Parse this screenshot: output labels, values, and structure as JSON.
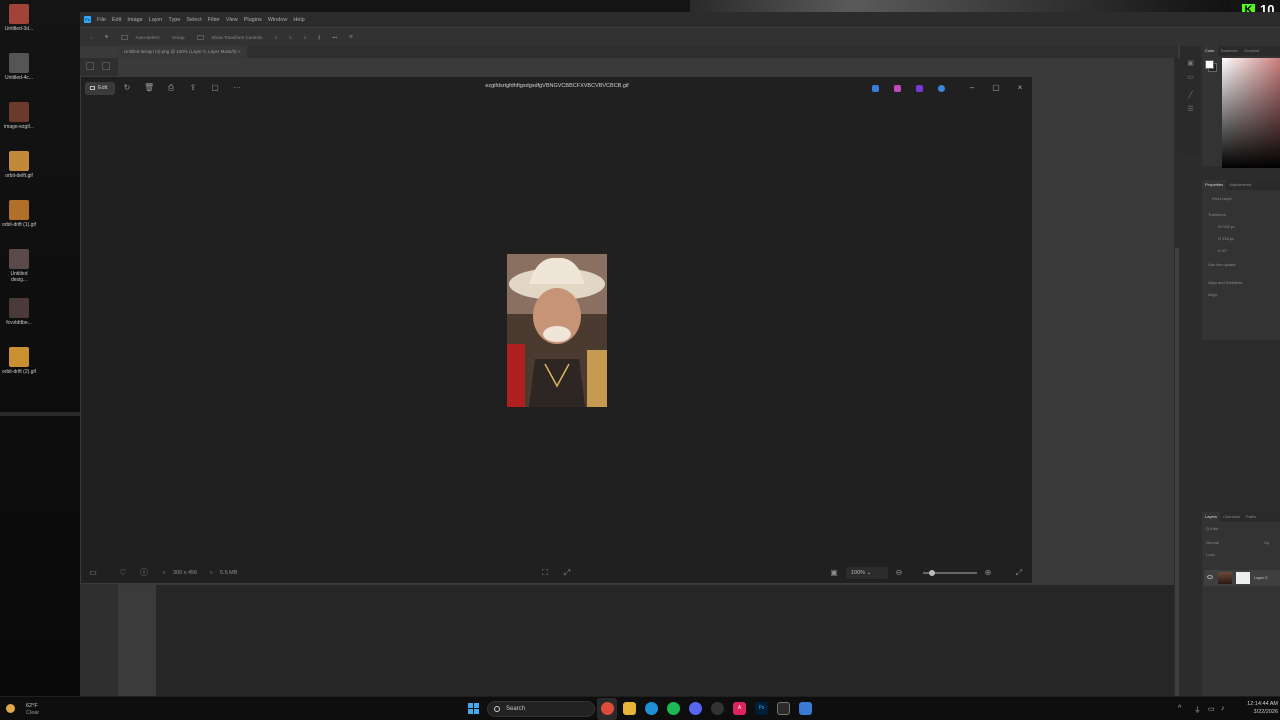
{
  "desktop": {
    "icons": [
      {
        "label": "Untitled-3d...",
        "color": "#a0443a"
      },
      {
        "label": "Untitled-4c...",
        "color": "#555555"
      },
      {
        "label": "image-ezgif...",
        "color": "#6a3a2a"
      },
      {
        "label": "orbit-delft.gif",
        "color": "#c08a3a"
      },
      {
        "label": "orbit-drift (1).gif",
        "color": "#b0702a"
      },
      {
        "label": "Untitled desig...",
        "color": "#5a4a4a"
      },
      {
        "label": "fcvvbfdbe...",
        "color": "#4a3a3a"
      },
      {
        "label": "orbit-drift (2).gif",
        "color": "#c89030"
      }
    ]
  },
  "photoshop": {
    "menu": [
      "File",
      "Edit",
      "Image",
      "Layer",
      "Type",
      "Select",
      "Filter",
      "View",
      "Plugins",
      "Window",
      "Help"
    ],
    "options": {
      "auto_select": "Auto-Select:",
      "layer_dropdown": "Group",
      "show_transform": "Show Transform Controls"
    },
    "tab_title": "Untitled design (4).png @ 100% (Layer 0, Layer Mask/8)",
    "panels": {
      "color_tabs": [
        "Color",
        "Swatches",
        "Gradient"
      ],
      "props_tabs": [
        "Properties",
        "Adjustments"
      ],
      "props_kind": "Pixel Layer",
      "transform_label": "Transform",
      "w_label": "W",
      "w_value": "128 px",
      "h_label": "H",
      "h_value": "128 px",
      "angle_value": "0.00°",
      "use_live": "Use live update",
      "align_label": "Align and Distribute",
      "align_sub": "Align:",
      "layers_tabs": [
        "Layers",
        "Channels",
        "Paths"
      ],
      "kind_label": "Q Kind",
      "blend_mode": "Normal",
      "opacity_label": "Op",
      "lock_label": "Lock:",
      "layer_name": "Layer 0"
    }
  },
  "viewer": {
    "edit_label": "Edit",
    "file_title": "ezgifdsrtgfdhftgsdgsdfgVBNGVCBBCFXVBCVBVCBCB.gif",
    "dimensions": "300 x 456",
    "file_size": "5.5 MB",
    "zoom": "100%"
  },
  "taskbar": {
    "temp": "62°F",
    "condition": "Clear",
    "search_placeholder": "Search",
    "time": "12:14:44 AM",
    "date": "3/22/2026"
  },
  "overlay": {
    "kick_count": "10"
  },
  "colors": {
    "accent": "#31a8ff",
    "kick_green": "#53fc18"
  }
}
